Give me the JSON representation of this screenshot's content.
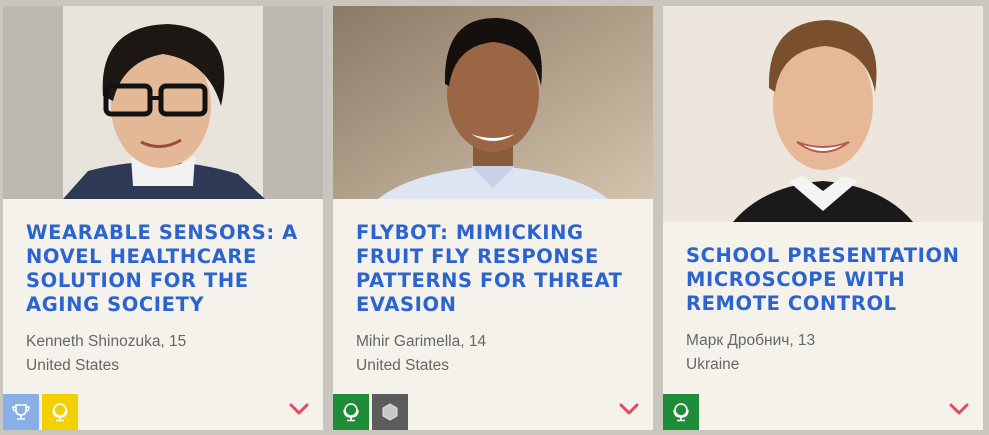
{
  "colors": {
    "title": "#2c64cf",
    "meta": "#666666",
    "card_bg": "#f5f2ec",
    "page_bg": "#c9c6c0",
    "chevron": "#e64a5a",
    "badge_blue": "#8aaee6",
    "badge_yellow": "#f5d000",
    "badge_green": "#1f8c3a",
    "badge_gray": "#5c5c5c"
  },
  "cards": [
    {
      "title": "Wearable Sensors: A Novel Healthcare Solution for the Aging Society",
      "author": "Kenneth Shinozuka, 15",
      "country": "United States",
      "photo_icon": "portrait-photo",
      "badges": [
        {
          "icon": "trophy-icon",
          "color": "#8aaee6"
        },
        {
          "icon": "globe-icon",
          "color": "#f5d000"
        }
      ],
      "expand_icon": "chevron-down-icon"
    },
    {
      "title": "Flybot: Mimicking Fruit Fly Response Patterns for Threat Evasion",
      "author": "Mihir Garimella, 14",
      "country": "United States",
      "photo_icon": "portrait-photo",
      "badges": [
        {
          "icon": "globe-icon",
          "color": "#1f8c3a"
        },
        {
          "icon": "hexagon-icon",
          "color": "#5c5c5c"
        }
      ],
      "expand_icon": "chevron-down-icon"
    },
    {
      "title": "School Presentation Microscope with Remote Control",
      "author": "Марк Дробнич, 13",
      "country": "Ukraine",
      "photo_icon": "portrait-photo",
      "badges": [
        {
          "icon": "globe-icon",
          "color": "#1f8c3a"
        }
      ],
      "expand_icon": "chevron-down-icon"
    }
  ]
}
